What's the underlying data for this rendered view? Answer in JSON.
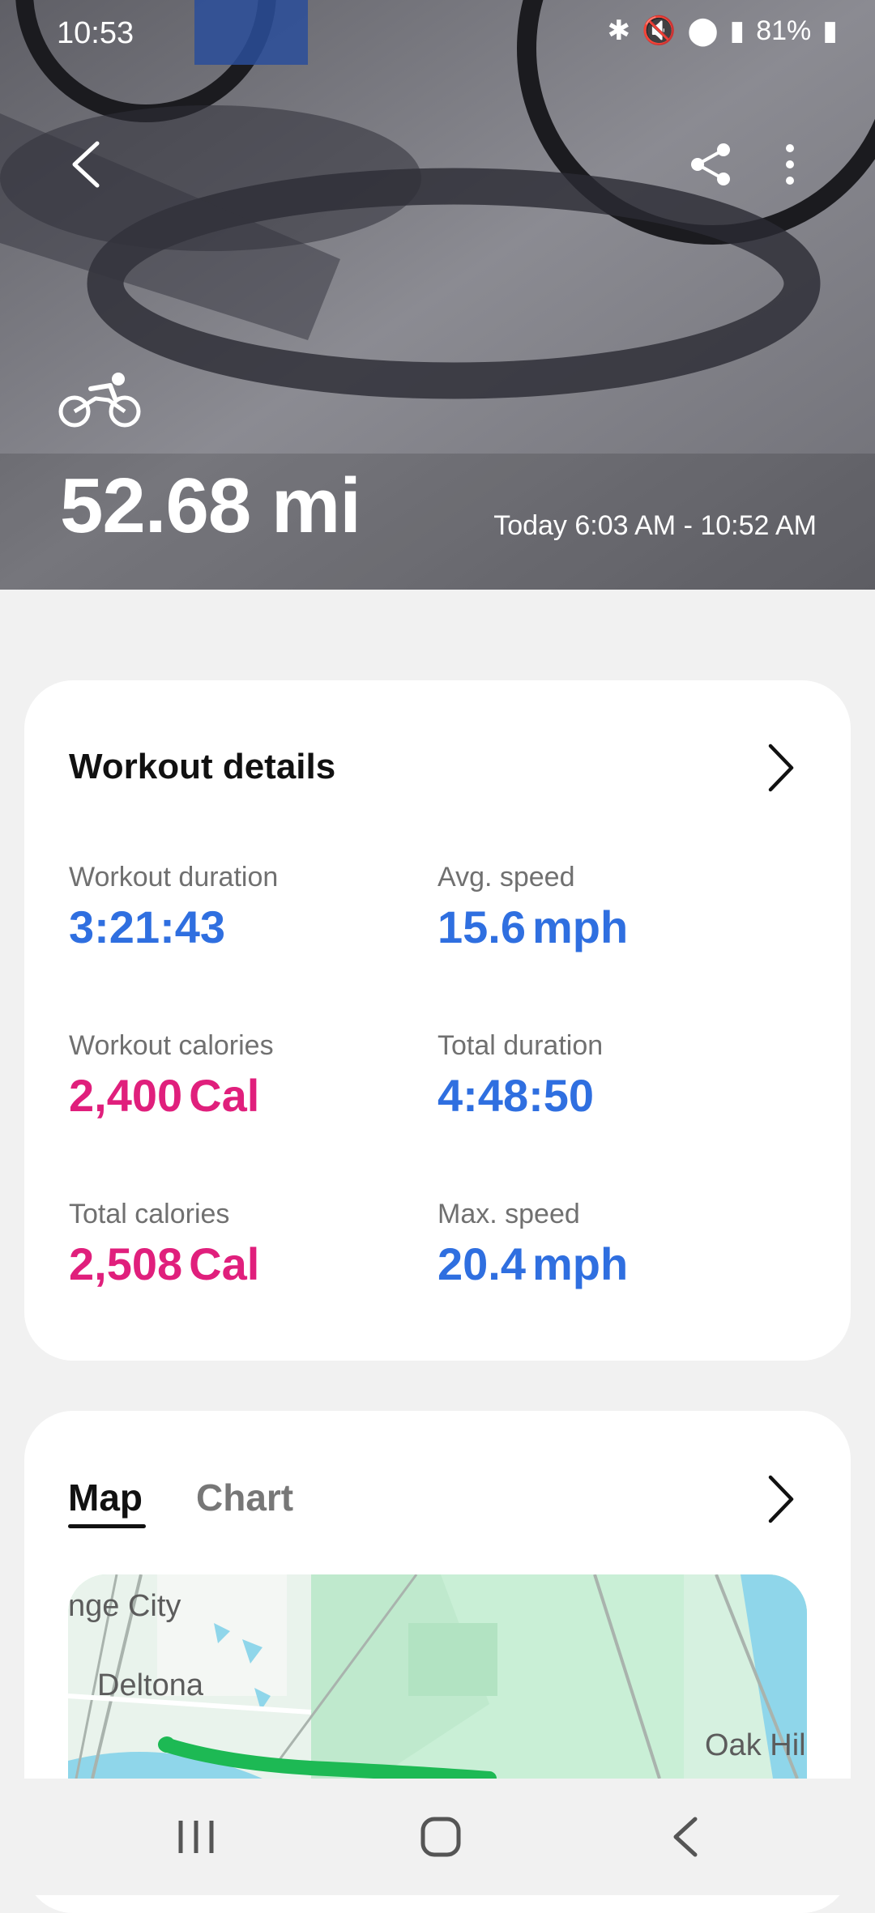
{
  "status_bar": {
    "time": "10:53",
    "battery": "81%"
  },
  "hero": {
    "activity_icon": "bicycle-icon",
    "distance": "52.68 mi",
    "time_range": "Today 6:03 AM - 10:52 AM"
  },
  "workout_details": {
    "title": "Workout details",
    "metrics": [
      {
        "label": "Workout duration",
        "value": "3:21:43",
        "unit": "",
        "color": "#2f6fe0"
      },
      {
        "label": "Avg. speed",
        "value": "15.6",
        "unit": "mph",
        "color": "#2f6fe0"
      },
      {
        "label": "Workout calories",
        "value": "2,400",
        "unit": "Cal",
        "color": "#e01f7c"
      },
      {
        "label": "Total duration",
        "value": "4:48:50",
        "unit": "",
        "color": "#2f6fe0"
      },
      {
        "label": "Total calories",
        "value": "2,508",
        "unit": "Cal",
        "color": "#e01f7c"
      },
      {
        "label": "Max. speed",
        "value": "20.4",
        "unit": "mph",
        "color": "#2f6fe0"
      }
    ]
  },
  "map_section": {
    "tabs": [
      {
        "label": "Map",
        "selected": true
      },
      {
        "label": "Chart",
        "selected": false
      }
    ],
    "map_labels": {
      "city1": "nge City",
      "city2": "Deltona",
      "city3": "Oak Hil"
    }
  },
  "colors": {
    "accent_blue": "#2f6fe0",
    "accent_pink": "#e01f7c",
    "route_green": "#1db954"
  }
}
